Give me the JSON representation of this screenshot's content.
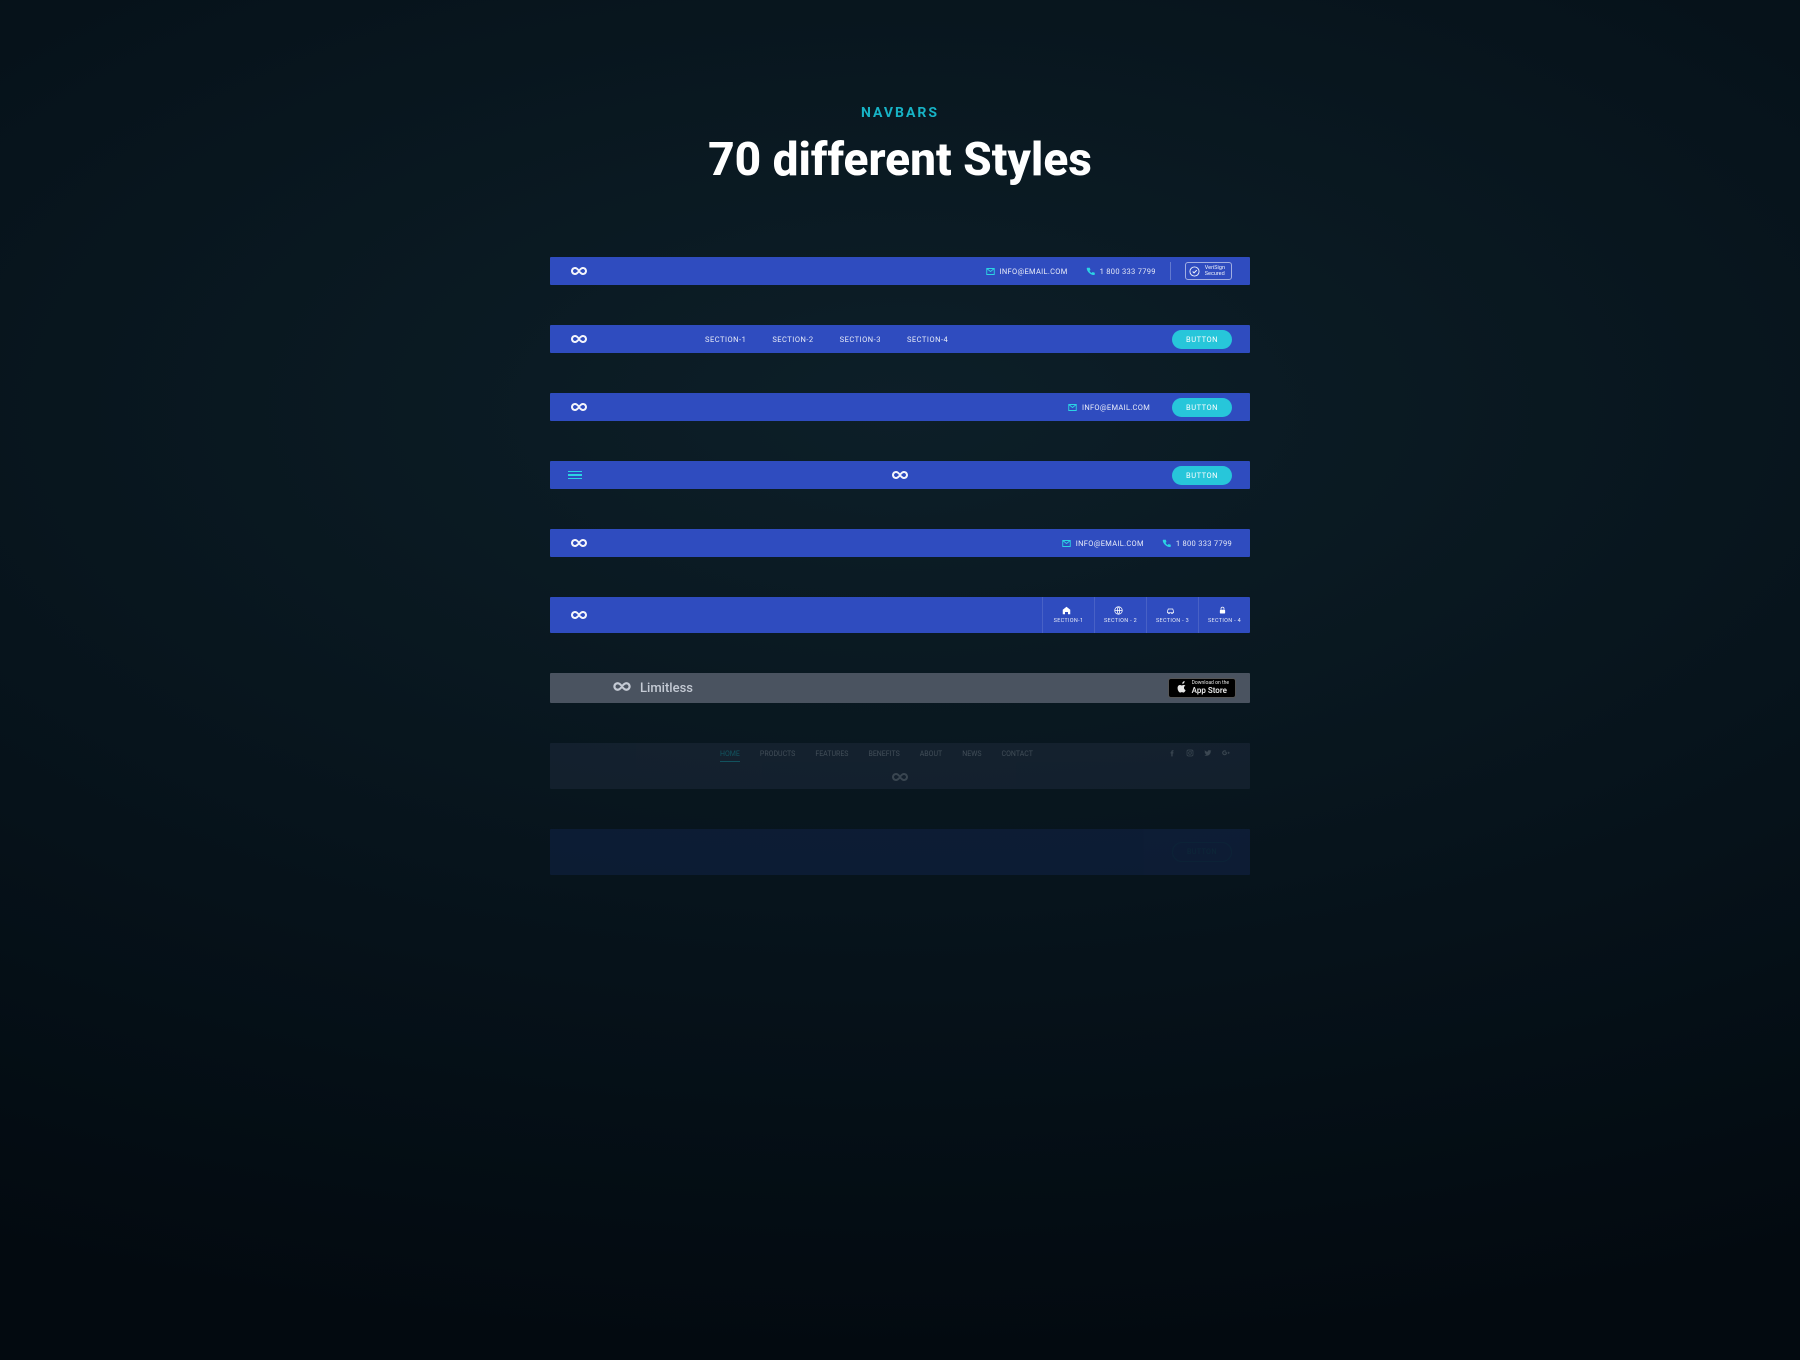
{
  "header": {
    "eyebrow": "NAVBARS",
    "title": "70 different Styles"
  },
  "common": {
    "email": "INFO@EMAIL.COM",
    "phone": "1 800 333 7799",
    "button_label": "BUTTON",
    "verisign": "VeriSign\nSecured"
  },
  "nav2": {
    "links": [
      "SECTION-1",
      "SECTION-2",
      "SECTION-3",
      "SECTION-4"
    ]
  },
  "nav6": {
    "cells": [
      {
        "label": "SECTION-1",
        "icon": "home"
      },
      {
        "label": "SECTION - 2",
        "icon": "globe"
      },
      {
        "label": "SECTION - 3",
        "icon": "car"
      },
      {
        "label": "SECTION - 4",
        "icon": "lock"
      }
    ]
  },
  "nav7": {
    "brand": "Limitless",
    "appstore_small": "Download on the",
    "appstore_big": "App Store"
  },
  "nav8": {
    "tabs": [
      "HOME",
      "PRODUCTS",
      "FEATURES",
      "BENEFITS",
      "ABOUT",
      "NEWS",
      "CONTACT"
    ]
  }
}
